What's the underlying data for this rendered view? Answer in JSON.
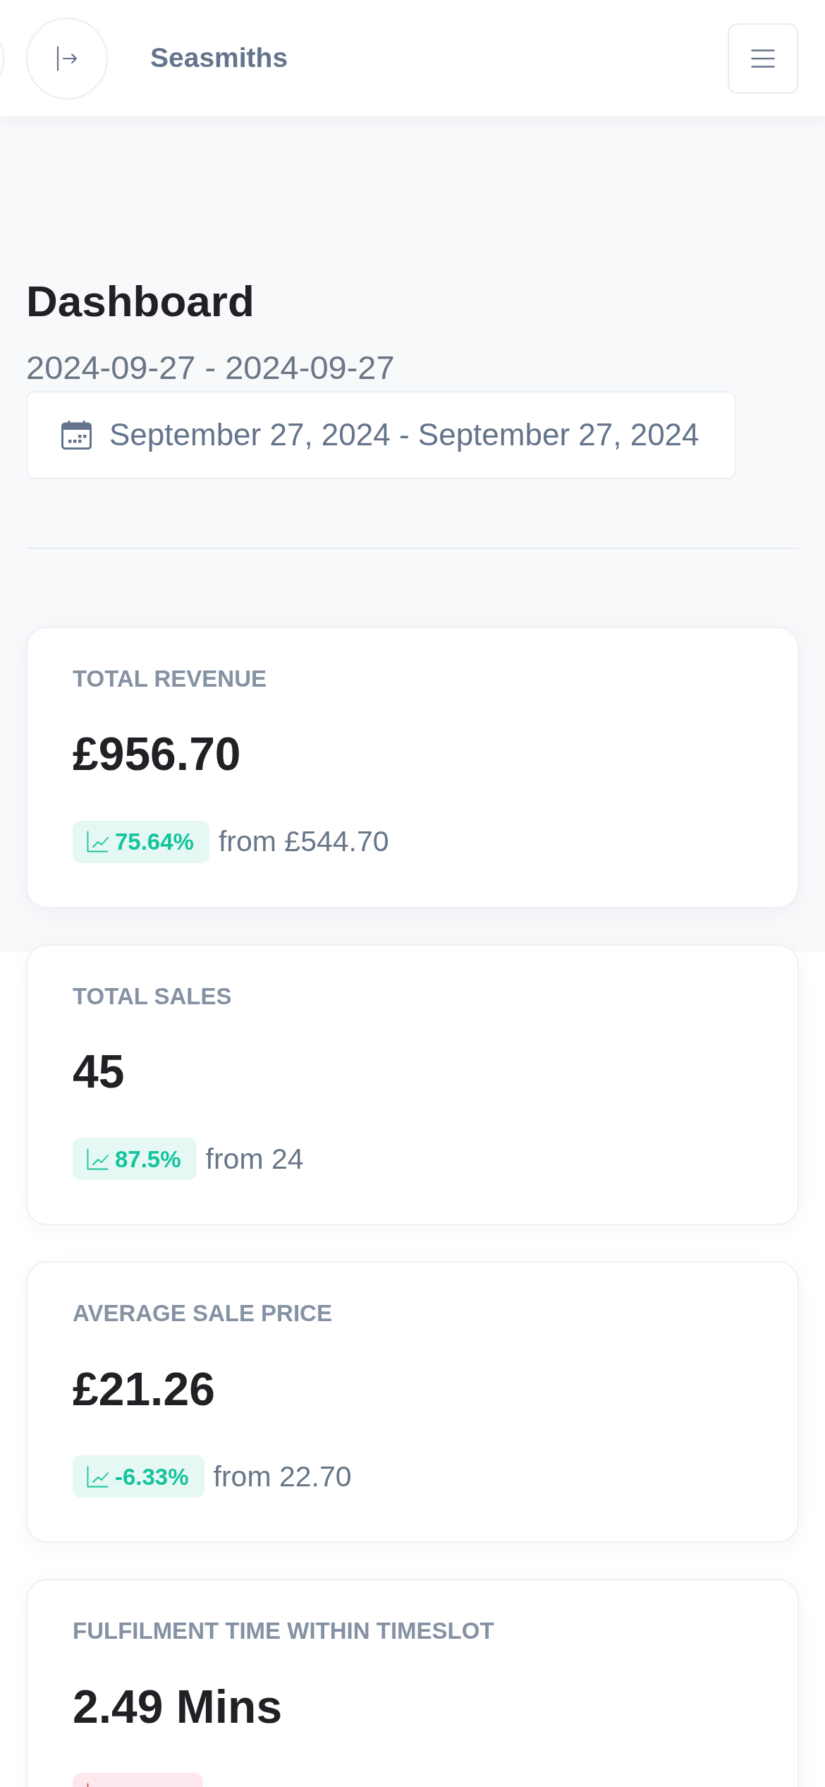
{
  "header": {
    "brand": "Seasmiths"
  },
  "page": {
    "title": "Dashboard",
    "date_range": "2024-09-27 - 2024-09-27",
    "date_picker": {
      "value": "September 27, 2024 - September 27, 2024"
    }
  },
  "cards": [
    {
      "label": "TOTAL REVENUE",
      "value": "£956.70",
      "change": {
        "kind": "up",
        "text": "75.64%"
      },
      "comparison": "from £544.70"
    },
    {
      "label": "TOTAL SALES",
      "value": "45",
      "change": {
        "kind": "up",
        "text": "87.5%"
      },
      "comparison": "from 24"
    },
    {
      "label": "AVERAGE SALE PRICE",
      "value": "£21.26",
      "change": {
        "kind": "up",
        "text": "-6.33%"
      },
      "comparison": "from 22.70"
    },
    {
      "label": "FULFILMENT TIME WITHIN TIMESLOT",
      "value": "2.49 Mins",
      "change": {
        "kind": "down"
      }
    }
  ]
}
